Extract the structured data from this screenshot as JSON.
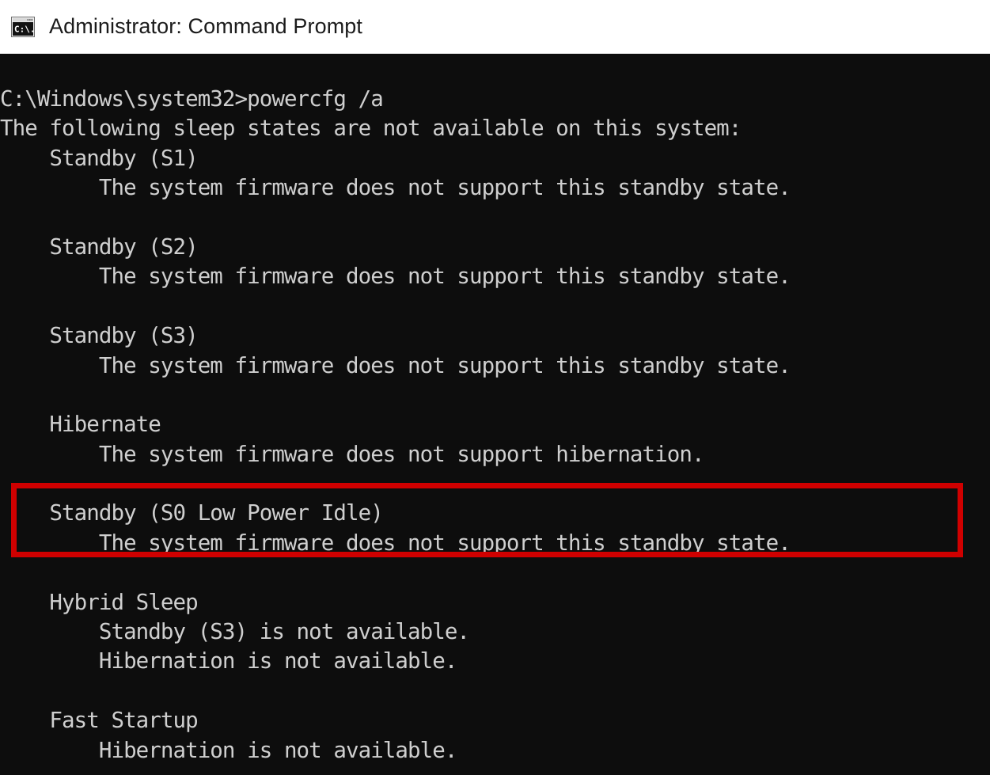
{
  "window": {
    "title": "Administrator: Command Prompt",
    "icon": "command-prompt-icon",
    "icon_label": "C:\\.",
    "titlebar_bg": "#ffffff",
    "titlebar_fg": "#1b1b1b",
    "terminal_bg": "#0d0d0d",
    "terminal_fg": "#cfcfcf"
  },
  "terminal": {
    "prompt_path": "C:\\Windows\\system32>",
    "command": "powercfg /a",
    "lines": [
      "C:\\Windows\\system32>powercfg /a",
      "The following sleep states are not available on this system:",
      "    Standby (S1)",
      "        The system firmware does not support this standby state.",
      "",
      "    Standby (S2)",
      "        The system firmware does not support this standby state.",
      "",
      "    Standby (S3)",
      "        The system firmware does not support this standby state.",
      "",
      "    Hibernate",
      "        The system firmware does not support hibernation.",
      "",
      "    Standby (S0 Low Power Idle)",
      "        The system firmware does not support this standby state.",
      "",
      "    Hybrid Sleep",
      "        Standby (S3) is not available.",
      "        Hibernation is not available.",
      "",
      "    Fast Startup",
      "        Hibernation is not available."
    ],
    "sleep_states": [
      {
        "name": "Standby (S1)",
        "detail": "The system firmware does not support this standby state."
      },
      {
        "name": "Standby (S2)",
        "detail": "The system firmware does not support this standby state."
      },
      {
        "name": "Standby (S3)",
        "detail": "The system firmware does not support this standby state."
      },
      {
        "name": "Hibernate",
        "detail": "The system firmware does not support hibernation."
      },
      {
        "name": "Standby (S0 Low Power Idle)",
        "detail": "The system firmware does not support this standby state."
      },
      {
        "name": "Hybrid Sleep",
        "detail": "Standby (S3) is not available.\nHibernation is not available."
      },
      {
        "name": "Fast Startup",
        "detail": "Hibernation is not available."
      }
    ]
  },
  "annotation": {
    "type": "rectangle-highlight",
    "color": "#cf0000",
    "target_text": "Standby (S0 Low Power Idle)"
  }
}
